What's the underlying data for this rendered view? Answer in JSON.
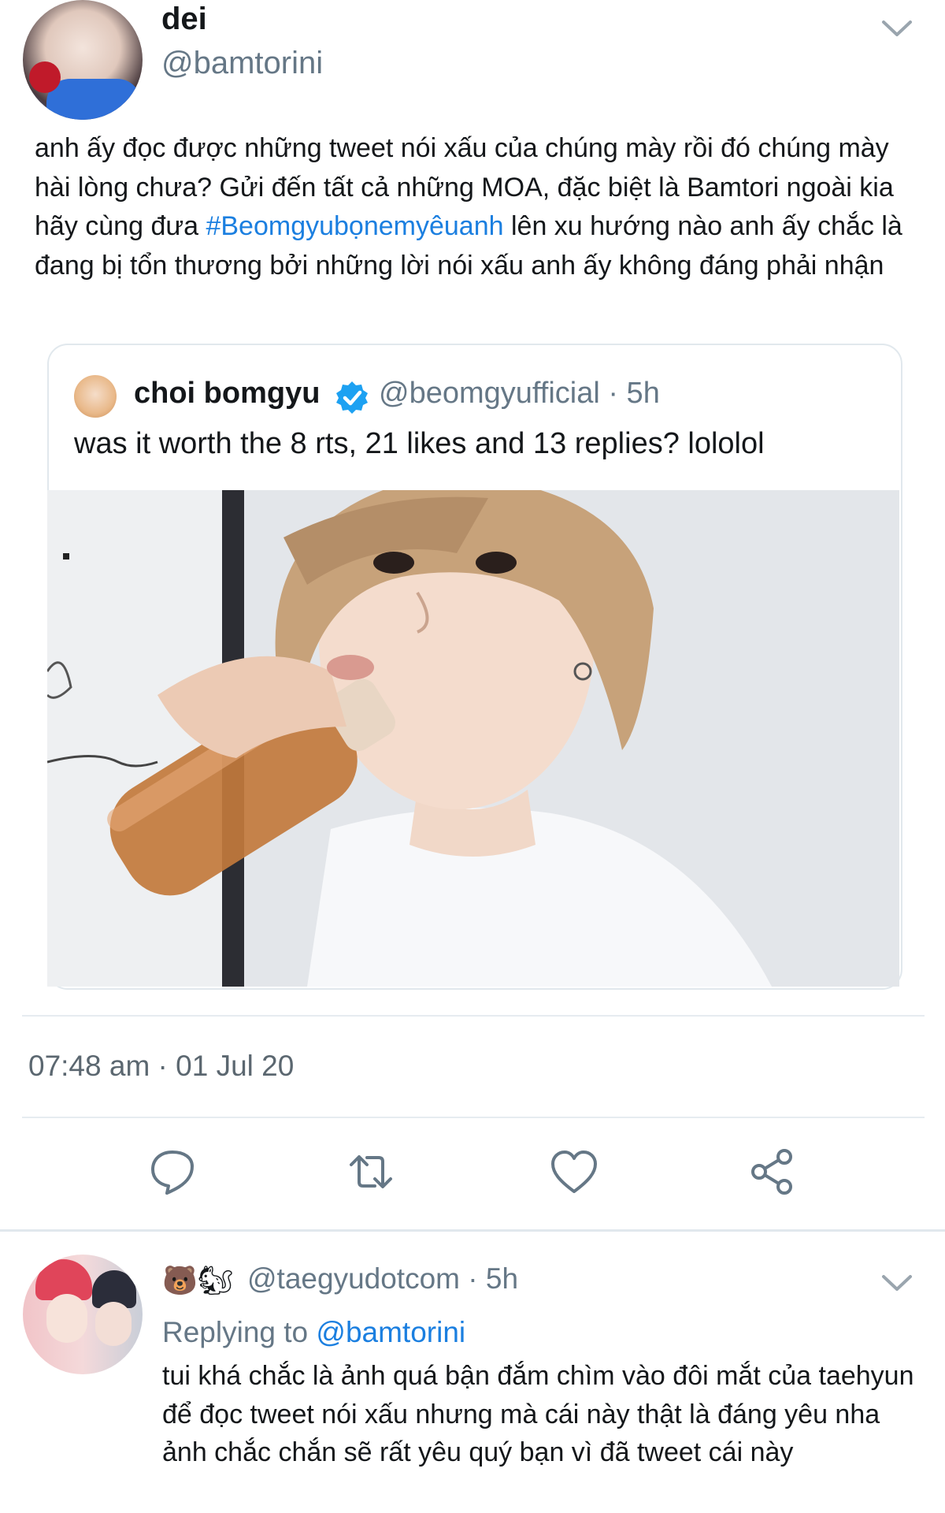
{
  "main_tweet": {
    "display_name": "dei",
    "handle": "@bamtorini",
    "text_before": "anh ấy đọc được những tweet nói xấu của chúng mày rồi đó chúng mày hài lòng chưa? Gửi đến tất cả những MOA, đặc biệt là Bamtori ngoài kia hãy cùng đưa ",
    "hashtag": "#Beomgyubọnemyêuanh",
    "text_after": " lên xu hướng nào anh ấy chắc là đang bị tổn thương bởi những lời nói xấu anh ấy không đáng phải nhận",
    "timestamp": "07:48 am · 01 Jul 20"
  },
  "quoted_tweet": {
    "display_name": "choi bomgyu",
    "handle_time": "@beomgyufficial · 5h",
    "text": "was it worth the 8 rts, 21 likes and 13 replies? lololol"
  },
  "actions": {
    "reply_icon": "speech-bubble-icon",
    "retweet_icon": "retweet-icon",
    "like_icon": "heart-icon",
    "share_icon": "share-icon"
  },
  "reply": {
    "emojis": "🐻🐿",
    "handle_time": "@taegyudotcom · 5h",
    "replying_prefix": "Replying to",
    "replying_mention": "@bamtorini",
    "text": "tui khá chắc là ảnh quá bận đắm chìm vào đôi mắt của taehyun để đọc tweet nói xấu nhưng mà cái này thật là đáng yêu nha ảnh chắc chắn sẽ rất yêu quý bạn vì đã tweet cái này"
  },
  "colors": {
    "link": "#1b7fe0",
    "muted": "#657786",
    "verified": "#1da1f2"
  }
}
